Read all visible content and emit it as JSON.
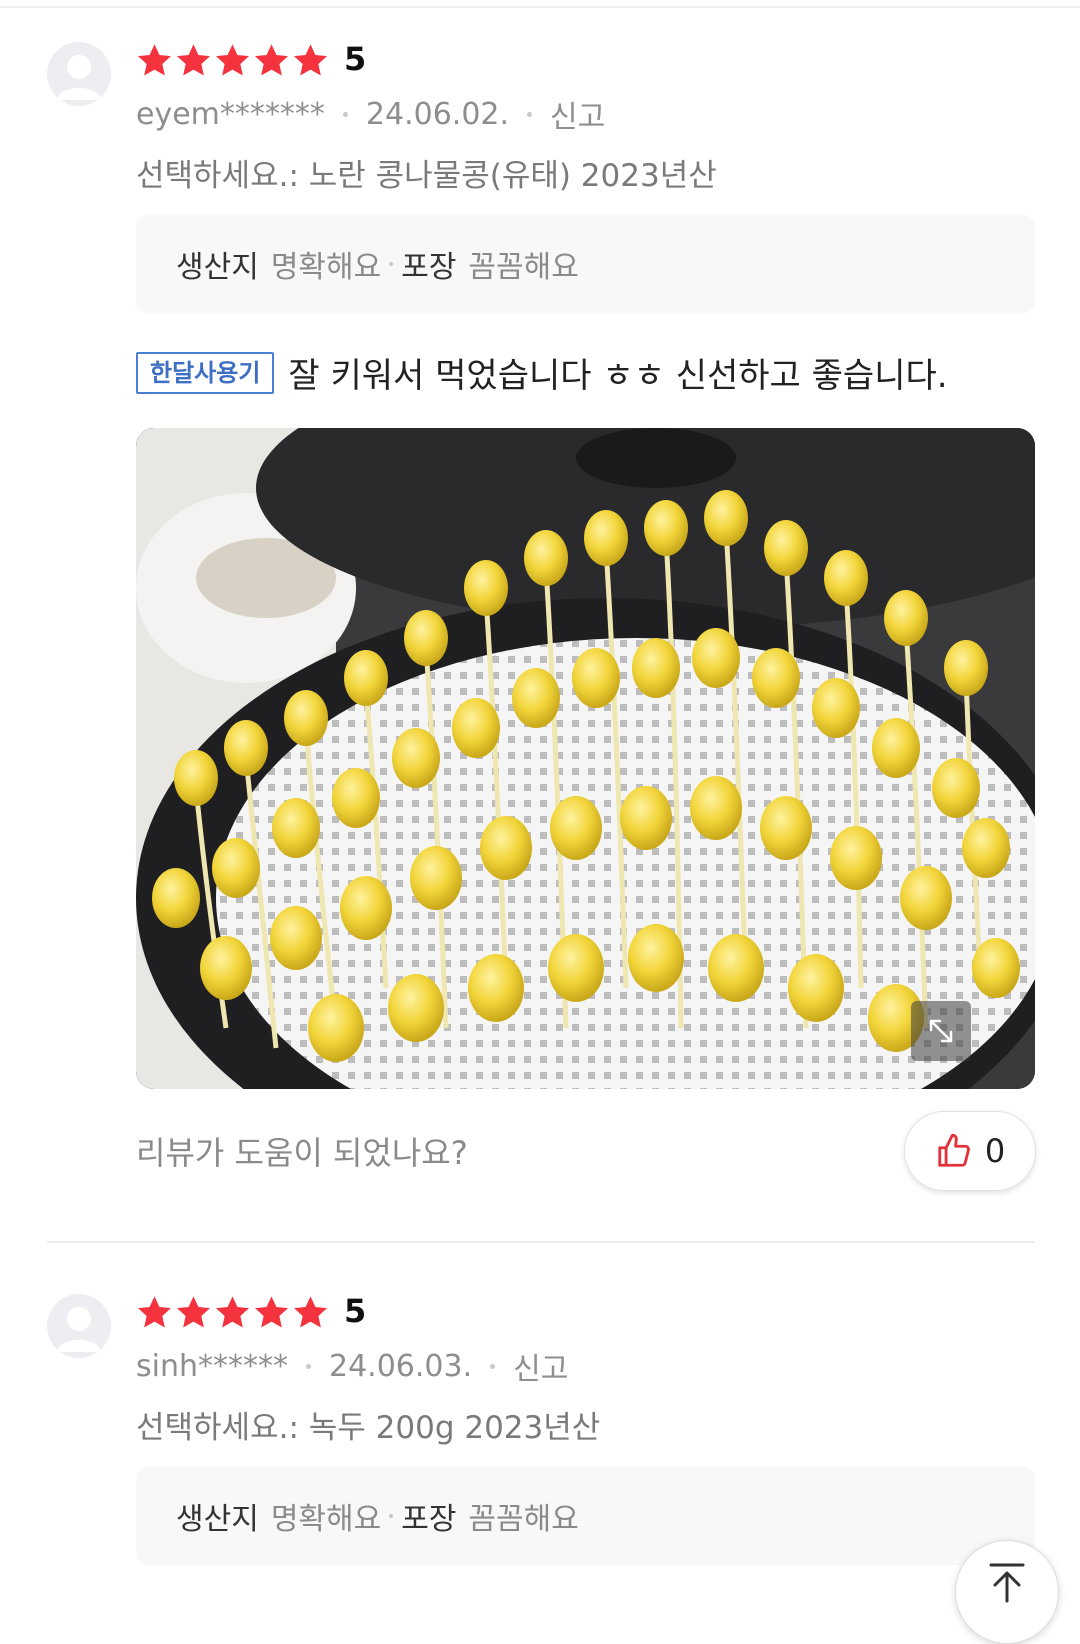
{
  "reviews": [
    {
      "rating": "5",
      "rating_value": 5,
      "user": "eyem*******",
      "date": "24.06.02.",
      "report_label": "신고",
      "option": "선택하세요.: 노란 콩나물콩(유태) 2023년산",
      "tags": [
        {
          "key": "생산지",
          "value": "명확해요"
        },
        {
          "key": "포장",
          "value": "꼼꼼해요"
        }
      ],
      "badge": "한달사용기",
      "text": "잘 키워서 먹었습니다 ㅎㅎ 신선하고 좋습니다.",
      "helpful_prompt": "리뷰가 도움이 되었나요?",
      "like_count": "0"
    },
    {
      "rating": "5",
      "rating_value": 5,
      "user": "sinh******",
      "date": "24.06.03.",
      "report_label": "신고",
      "option": "선택하세요.: 녹두 200g 2023년산",
      "tags": [
        {
          "key": "생산지",
          "value": "명확해요"
        },
        {
          "key": "포장",
          "value": "꼼꼼해요"
        }
      ]
    }
  ],
  "colors": {
    "star": "#f4333f",
    "badge": "#3d6fc4",
    "like_icon": "#e2323a"
  },
  "icons": {
    "avatar": "default-user-icon",
    "star": "star-icon",
    "like": "thumbs-up-icon",
    "expand": "expand-icon",
    "top": "scroll-to-top-icon"
  }
}
